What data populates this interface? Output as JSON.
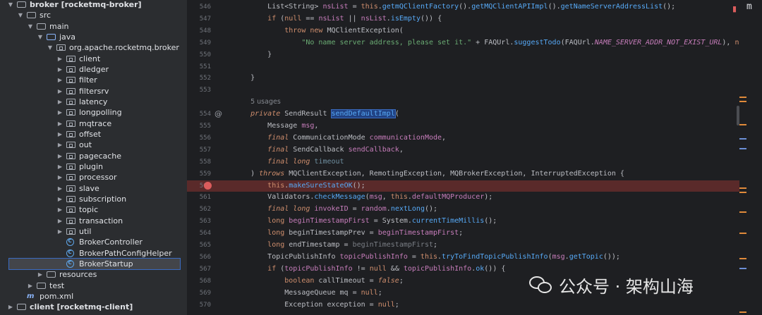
{
  "project_tree": {
    "items": [
      {
        "label": "broker [rocketmq-broker]",
        "depth": 0,
        "kind": "module",
        "expanded": true
      },
      {
        "label": "src",
        "depth": 1,
        "kind": "folder",
        "expanded": true
      },
      {
        "label": "main",
        "depth": 2,
        "kind": "folder",
        "expanded": true
      },
      {
        "label": "java",
        "depth": 3,
        "kind": "source",
        "expanded": true
      },
      {
        "label": "org.apache.rocketmq.broker",
        "depth": 4,
        "kind": "package",
        "expanded": true
      },
      {
        "label": "client",
        "depth": 5,
        "kind": "package",
        "expanded": false
      },
      {
        "label": "dledger",
        "depth": 5,
        "kind": "package",
        "expanded": false
      },
      {
        "label": "filter",
        "depth": 5,
        "kind": "package",
        "expanded": false
      },
      {
        "label": "filtersrv",
        "depth": 5,
        "kind": "package",
        "expanded": false
      },
      {
        "label": "latency",
        "depth": 5,
        "kind": "package",
        "expanded": false
      },
      {
        "label": "longpolling",
        "depth": 5,
        "kind": "package",
        "expanded": false
      },
      {
        "label": "mqtrace",
        "depth": 5,
        "kind": "package",
        "expanded": false
      },
      {
        "label": "offset",
        "depth": 5,
        "kind": "package",
        "expanded": false
      },
      {
        "label": "out",
        "depth": 5,
        "kind": "package",
        "expanded": false
      },
      {
        "label": "pagecache",
        "depth": 5,
        "kind": "package",
        "expanded": false
      },
      {
        "label": "plugin",
        "depth": 5,
        "kind": "package",
        "expanded": false
      },
      {
        "label": "processor",
        "depth": 5,
        "kind": "package",
        "expanded": false
      },
      {
        "label": "slave",
        "depth": 5,
        "kind": "package",
        "expanded": false
      },
      {
        "label": "subscription",
        "depth": 5,
        "kind": "package",
        "expanded": false
      },
      {
        "label": "topic",
        "depth": 5,
        "kind": "package",
        "expanded": false
      },
      {
        "label": "transaction",
        "depth": 5,
        "kind": "package",
        "expanded": false
      },
      {
        "label": "util",
        "depth": 5,
        "kind": "package",
        "expanded": false
      },
      {
        "label": "BrokerController",
        "depth": 5,
        "kind": "class"
      },
      {
        "label": "BrokerPathConfigHelper",
        "depth": 5,
        "kind": "class"
      },
      {
        "label": "BrokerStartup",
        "depth": 5,
        "kind": "class",
        "selected": true
      },
      {
        "label": "resources",
        "depth": 3,
        "kind": "folder",
        "expanded": false
      },
      {
        "label": "test",
        "depth": 2,
        "kind": "folder",
        "expanded": false
      },
      {
        "label": "pom.xml",
        "depth": 1,
        "kind": "maven"
      },
      {
        "label": "client [rocketmq-client]",
        "depth": 0,
        "kind": "module",
        "expanded": false
      }
    ]
  },
  "editor": {
    "usages_hint": "5 usages",
    "lines": [
      {
        "n": "546",
        "html": "        <span>List&lt;String&gt; </span><span class='fld'>nsList</span><span> = </span><span class='kw'>this</span><span>.</span><span class='mth'>getmQClientFactory</span><span>().</span><span class='mth'>getMQClientAPIImpl</span><span>().</span><span class='mth'>getNameServerAddressList</span><span>();</span>"
      },
      {
        "n": "547",
        "html": "        <span class='kw'>if</span><span> (</span><span class='kw'>null</span><span> == </span><span class='fld'>nsList</span><span> || </span><span class='fld'>nsList</span><span>.</span><span class='mth'>isEmpty</span><span>()) {</span>"
      },
      {
        "n": "548",
        "html": "            <span class='kw'>throw new</span><span> MQClientException(</span>"
      },
      {
        "n": "549",
        "html": "                <span class='str'>\"No name server address, please set it.\"</span><span> + FAQUrl.</span><span class='sm'>suggestTodo</span><span>(FAQUrl.</span><span class='st'>NAME_SERVER_ADDR_NOT_EXIST_URL</span><span>), </span><span class='kw'>nu</span>"
      },
      {
        "n": "550",
        "html": "        }"
      },
      {
        "n": "551",
        "html": ""
      },
      {
        "n": "552",
        "html": "    }"
      },
      {
        "n": "553",
        "html": ""
      },
      {
        "n": "",
        "hint": true,
        "html": "    <span class='hint'>5 usages</span>"
      },
      {
        "n": "554",
        "html": "    <span class='kwi'>private</span><span> SendResult </span><span class='mth sel'>sendDefaultImpl</span><span>(</span>"
      },
      {
        "n": "555",
        "html": "        <span>Message </span><span class='prm'>msg</span><span>,</span>"
      },
      {
        "n": "556",
        "html": "        <span class='kwi'>final</span><span> CommunicationMode </span><span class='prm'>communicationMode</span><span>,</span>"
      },
      {
        "n": "557",
        "html": "        <span class='kwi'>final</span><span> SendCallback </span><span class='prm'>sendCallback</span><span>,</span>"
      },
      {
        "n": "558",
        "html": "        <span class='kwi'>final long</span><span> </span><span class='unused'>timeout</span>"
      },
      {
        "n": "559",
        "html": "    <span>) </span><span class='kwi'>throws</span><span> MQClientException, RemotingException, MQBrokerException, InterruptedException {</span>"
      },
      {
        "n": "560",
        "bp": true,
        "html": "        <span class='kw'>this</span><span>.</span><span class='mth'>makeSureStateOK</span><span>();</span>"
      },
      {
        "n": "561",
        "html": "        <span>Validators.</span><span class='sm'>checkMessage</span><span>(</span><span class='prm'>msg</span><span>, </span><span class='kw'>this</span><span>.</span><span class='fld'>defaultMQProducer</span><span>);</span>"
      },
      {
        "n": "562",
        "html": "        <span class='kwi'>final long</span><span> </span><span class='prm'>invokeID</span><span> = </span><span class='fld'>random</span><span>.</span><span class='mth'>nextLong</span><span>();</span>"
      },
      {
        "n": "563",
        "html": "        <span class='kw'>long</span><span> </span><span class='prm'>beginTimestampFirst</span><span> = System.</span><span class='sm'>currentTimeMillis</span><span>();</span>"
      },
      {
        "n": "564",
        "html": "        <span class='kw'>long</span><span> beginTimestampPrev = </span><span class='prm'>beginTimestampFirst</span><span>;</span>"
      },
      {
        "n": "565",
        "html": "        <span class='kw'>long</span><span> endTimestamp = </span><span class='gry'>beginTimestampFirst</span><span>;</span>"
      },
      {
        "n": "566",
        "html": "        <span>TopicPublishInfo </span><span class='prm'>topicPublishInfo</span><span> = </span><span class='kw'>this</span><span>.</span><span class='mth'>tryToFindTopicPublishInfo</span><span>(</span><span class='prm'>msg</span><span>.</span><span class='mth'>getTopic</span><span>());</span>"
      },
      {
        "n": "567",
        "html": "        <span class='kw'>if</span><span> (</span><span class='prm'>topicPublishInfo</span><span> != </span><span class='kw'>null</span><span> &amp;&amp; </span><span class='prm'>topicPublishInfo</span><span>.</span><span class='mth'>ok</span><span>()) {</span>"
      },
      {
        "n": "568",
        "html": "            <span class='kw'>boolean</span><span> callTimeout = </span><span class='kwi'>false</span><span>;</span>"
      },
      {
        "n": "569",
        "html": "            <span>MessageQueue mq = </span><span class='kw'>null</span><span>;</span>"
      },
      {
        "n": "570",
        "html": "            <span>Exception exception = </span><span class='kw'>null</span><span>;</span>"
      }
    ]
  },
  "right_bar": {
    "label": "m"
  },
  "watermark": {
    "text": "公众号 · 架构山海"
  }
}
